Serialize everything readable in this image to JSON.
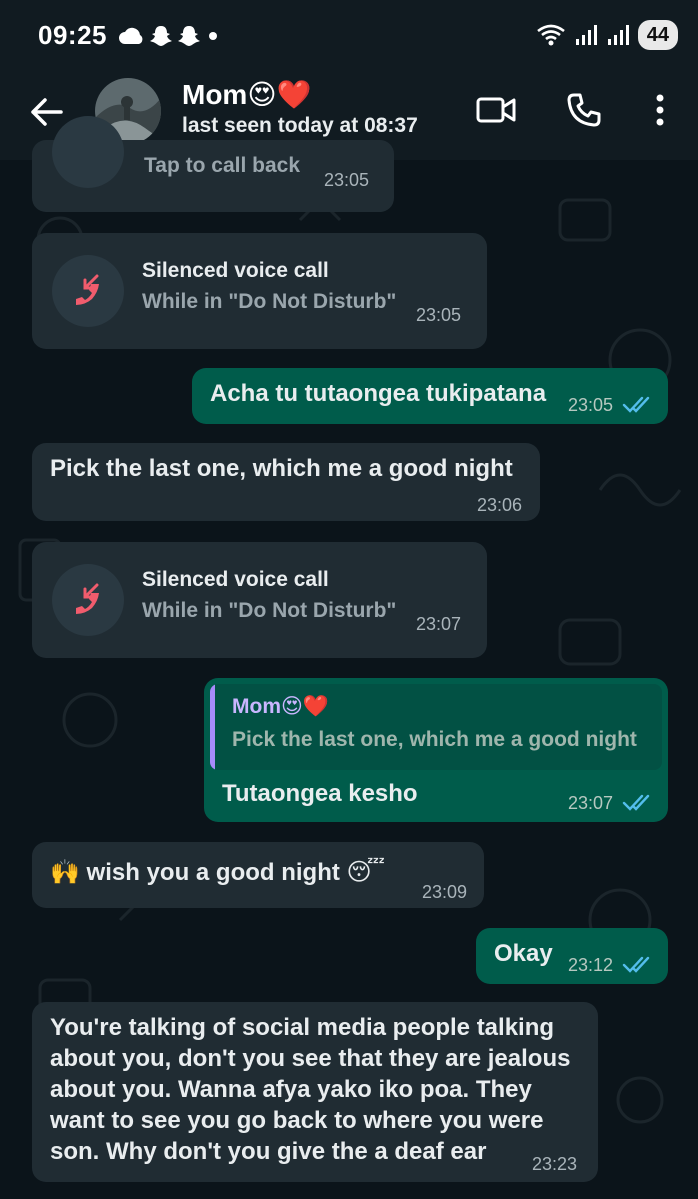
{
  "status_bar": {
    "time": "09:25",
    "battery": "44"
  },
  "header": {
    "name": "Mom😍❤️",
    "status": "last seen today at 08:37"
  },
  "messages": [
    {
      "type": "call-partial",
      "subtitle": "Tap to call back",
      "time": "23:05"
    },
    {
      "type": "call",
      "title": "Silenced voice call",
      "subtitle": "While in \"Do Not Disturb\"",
      "time": "23:05"
    },
    {
      "type": "out",
      "text": "Acha tu tutaongea tukipatana",
      "time": "23:05"
    },
    {
      "type": "in",
      "text": "Pick the last one, which me a good night",
      "time": "23:06"
    },
    {
      "type": "call",
      "title": "Silenced voice call",
      "subtitle": "While in \"Do Not Disturb\"",
      "time": "23:07"
    },
    {
      "type": "out-reply",
      "quote_name": "Mom😍❤️",
      "quote_text": "Pick the last one, which me a good night",
      "text": "Tutaongea kesho",
      "time": "23:07"
    },
    {
      "type": "in",
      "text": "🙌 wish you a good night 😴",
      "time": "23:09"
    },
    {
      "type": "out",
      "text": "Okay",
      "time": "23:12"
    },
    {
      "type": "in",
      "lines": [
        "You're talking of social media people talking",
        "about you, don't you see that they are jealous",
        "about you. Wanna afya yako iko poa. They",
        "want to see you go back to where you were",
        "son. Why don't you give the a deaf ear"
      ],
      "time": "23:23"
    }
  ],
  "colors": {
    "incoming": "#202c33",
    "outgoing": "#005c4b",
    "missed_call": "#f15c6d",
    "read_ticks": "#53bdeb"
  }
}
